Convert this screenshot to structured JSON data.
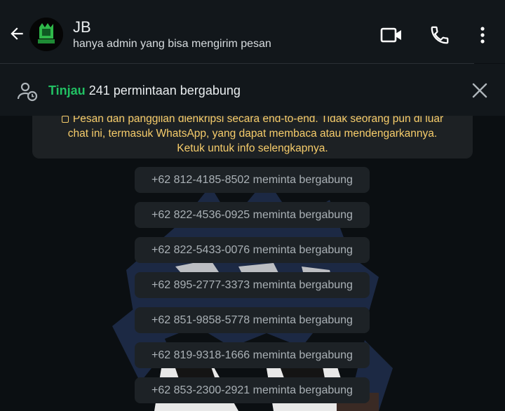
{
  "header": {
    "title": "JB",
    "subtitle": "hanya admin yang bisa mengirim pesan",
    "avatar_icon": "group-avatar-logo"
  },
  "join_banner": {
    "link": "Tinjau",
    "text": "241 permintaan bergabung"
  },
  "encryption": {
    "line1": "Pesan dan panggilan dienkripsi secara end-to-end. Tidak seorang pun di luar",
    "line2": "chat ini, termasuk WhatsApp, yang dapat membaca atau mendengarkannya.",
    "line3": "Ketuk untuk info selengkapnya."
  },
  "messages": [
    "+62 812-4185-8502 meminta bergabung",
    "+62 822-4536-0925 meminta bergabung",
    "+62 822-5433-0076 meminta bergabung",
    "+62 895-2777-3373 meminta bergabung",
    "+62 851-9858-5778 meminta bergabung",
    "+62 819-9318-1666 meminta bergabung",
    "+62 853-2300-2921 meminta bergabung"
  ],
  "colors": {
    "accent": "#21c063",
    "notice": "#f7cd6b",
    "header_bg": "#12171b"
  }
}
